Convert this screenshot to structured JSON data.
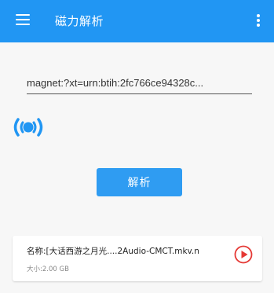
{
  "appbar": {
    "title": "磁力解析",
    "background": "#2196f3",
    "menu_icon": "hamburger-icon",
    "more_icon": "more-vertical-icon"
  },
  "magnet_input": {
    "value": "magnet:?xt=urn:btih:2fc766ce94328c..."
  },
  "play_mode_icon": "radio-waves-icon",
  "parse_button": {
    "label": "解析",
    "color": "#2f9cf2"
  },
  "result_card": {
    "name": "名称:[大话西游之月光....2Audio-CMCT.mkv.n",
    "size": "大小:2.00 GB",
    "play_icon": "play-circle-icon",
    "play_icon_color": "#e53935"
  }
}
